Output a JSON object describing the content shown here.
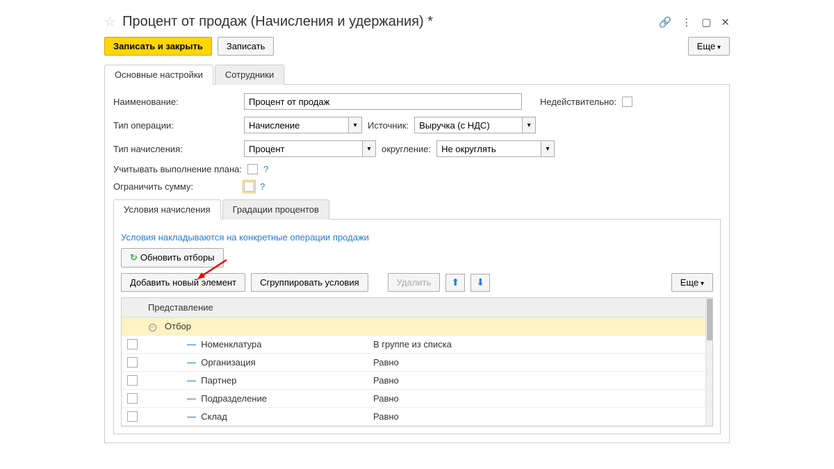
{
  "title": "Процент от продаж (Начисления и удержания) *",
  "toolbar": {
    "save_close": "Записать и закрыть",
    "save": "Записать",
    "more": "Еще"
  },
  "main_tabs": {
    "settings": "Основные настройки",
    "employees": "Сотрудники"
  },
  "form": {
    "name_label": "Наименование:",
    "name_value": "Процент от продаж",
    "invalid_label": "Недействительно:",
    "optype_label": "Тип операции:",
    "optype_value": "Начисление",
    "source_label": "Источник:",
    "source_value": "Выручка (с НДС)",
    "calctype_label": "Тип начисления:",
    "calctype_value": "Процент",
    "rounding_label": "округление:",
    "rounding_value": "Не округлять",
    "plan_label": "Учитывать выполнение плана:",
    "limit_label": "Ограничить сумму:"
  },
  "sub_tabs": {
    "conditions": "Условия начисления",
    "gradations": "Градации процентов"
  },
  "hint": "Условия накладываются на конкретные операции продажи",
  "buttons": {
    "refresh": "Обновить отборы",
    "add": "Добавить новый элемент",
    "group": "Сгруппировать условия",
    "delete": "Удалить",
    "more": "Еще"
  },
  "table": {
    "header": "Представление",
    "group_row": "Отбор",
    "rows": [
      {
        "name": "Номенклатура",
        "value": "В группе из списка"
      },
      {
        "name": "Организация",
        "value": "Равно"
      },
      {
        "name": "Партнер",
        "value": "Равно"
      },
      {
        "name": "Подразделение",
        "value": "Равно"
      },
      {
        "name": "Склад",
        "value": "Равно"
      }
    ]
  }
}
